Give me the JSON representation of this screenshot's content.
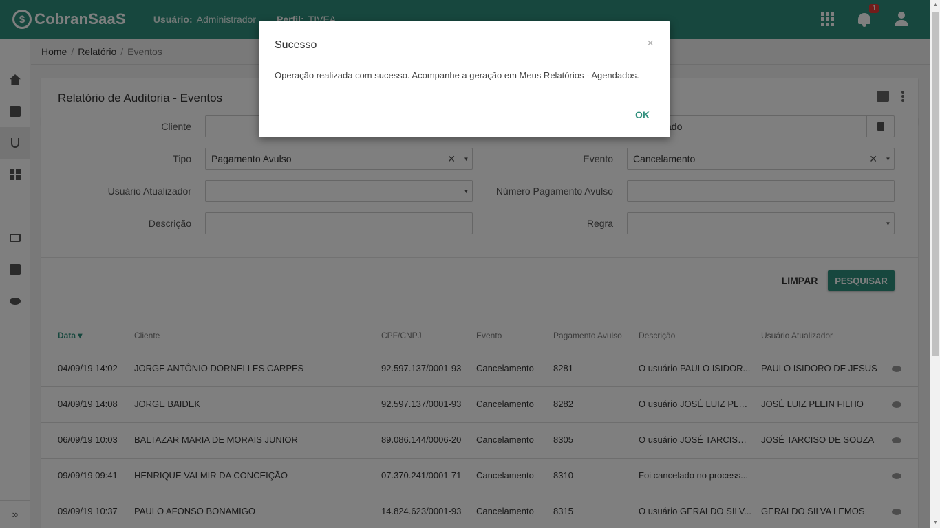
{
  "header": {
    "logo": "CobranSaaS",
    "user_label": "Usuário:",
    "user_value": "Administrador",
    "profile_label": "Perfil:",
    "profile_value": "TIVEA",
    "notification_count": "1"
  },
  "breadcrumb": {
    "home": "Home",
    "report": "Relatório",
    "current": "Eventos"
  },
  "page": {
    "title": "Relatório de Auditoria - Eventos"
  },
  "form": {
    "cliente_label": "Cliente",
    "cliente_value": "",
    "right_top_value": "ado",
    "tipo_label": "Tipo",
    "tipo_value": "Pagamento Avulso",
    "evento_label": "Evento",
    "evento_value": "Cancelamento",
    "usuario_label": "Usuário Atualizador",
    "usuario_value": "",
    "numero_label": "Número Pagamento Avulso",
    "numero_value": "",
    "descricao_label": "Descrição",
    "descricao_value": "",
    "regra_label": "Regra",
    "regra_value": ""
  },
  "buttons": {
    "limpar": "LIMPAR",
    "pesquisar": "PESQUISAR"
  },
  "table": {
    "headers": {
      "data": "Data",
      "cliente": "Cliente",
      "cpf": "CPF/CNPJ",
      "evento": "Evento",
      "pagamento": "Pagamento Avulso",
      "descricao": "Descrição",
      "usuario": "Usuário Atualizador"
    },
    "rows": [
      {
        "data": "04/09/19 14:02",
        "cliente": "JORGE ANTÔNIO DORNELLES CARPES",
        "cpf": "92.597.137/0001-93",
        "evento": "Cancelamento",
        "pagamento": "8281",
        "descricao": "O usuário PAULO ISIDOR...",
        "usuario": "PAULO ISIDORO DE JESUS"
      },
      {
        "data": "04/09/19 14:08",
        "cliente": "JORGE BAIDEK",
        "cpf": "92.597.137/0001-93",
        "evento": "Cancelamento",
        "pagamento": "8282",
        "descricao": "O usuário JOSÉ LUIZ PLEI...",
        "usuario": "JOSÉ LUIZ PLEIN FILHO"
      },
      {
        "data": "06/09/19 10:03",
        "cliente": "BALTAZAR MARIA DE MORAIS JUNIOR",
        "cpf": "89.086.144/0006-20",
        "evento": "Cancelamento",
        "pagamento": "8305",
        "descricao": "O usuário JOSÉ TARCISO ...",
        "usuario": "JOSÉ TARCISO DE SOUZA"
      },
      {
        "data": "09/09/19 09:41",
        "cliente": "HENRIQUE VALMIR DA CONCEIÇÃO",
        "cpf": "07.370.241/0001-71",
        "evento": "Cancelamento",
        "pagamento": "8310",
        "descricao": "Foi cancelado no process...",
        "usuario": ""
      },
      {
        "data": "09/09/19 10:37",
        "cliente": "PAULO AFONSO BONAMIGO",
        "cpf": "14.824.623/0001-93",
        "evento": "Cancelamento",
        "pagamento": "8315",
        "descricao": "O usuário GERALDO SILV...",
        "usuario": "GERALDO SILVA LEMOS"
      }
    ]
  },
  "modal": {
    "title": "Sucesso",
    "close": "×",
    "message": "Operação realizada com sucesso. Acompanhe a geração em Meus Relatórios - Agendados.",
    "ok": "OK"
  },
  "colors": {
    "brand": "#2f8f7c",
    "badge": "#e53935"
  },
  "icons": [
    "home-icon",
    "book-icon",
    "stethoscope-icon",
    "dashboard-icon",
    "card-icon",
    "money-icon",
    "wallet-icon",
    "eye-icon",
    "apps-grid-icon",
    "bell-icon",
    "user-icon",
    "print-icon",
    "kebab-icon",
    "trash-icon",
    "expand-icon"
  ]
}
